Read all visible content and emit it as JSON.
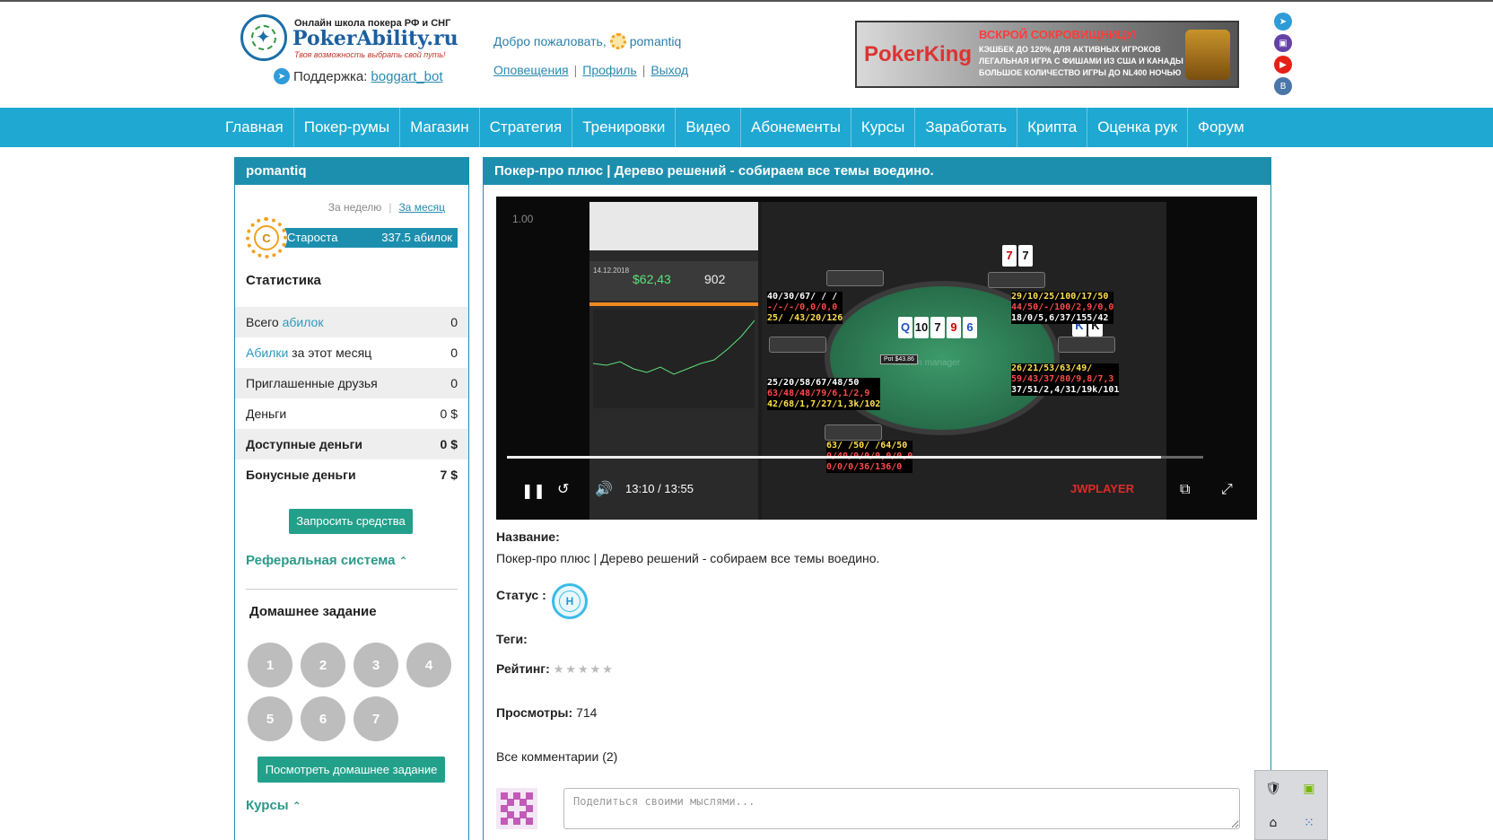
{
  "header": {
    "logo_tagline_top": "Онлайн школа покера РФ и СНГ",
    "logo_name": "PokerAbility.ru",
    "logo_tagline_bottom": "Твоя возможность выбрать свой путь!",
    "support_label": "Поддержка:",
    "support_link": "boggart_bot",
    "welcome": "Добро пожаловать,",
    "username": "pomantiq",
    "links": [
      "Оповещения",
      "Профиль",
      "Выход"
    ],
    "banner": {
      "brand_a": "Poker",
      "brand_b": "King",
      "headline": "ВСКРОЙ СОКРОВИЩНИЦУ!",
      "lines": [
        "КЭШБЕК ДО 120% ДЛЯ АКТИВНЫХ ИГРОКОВ",
        "ЛЕГАЛЬНАЯ ИГРА С ФИШАМИ ИЗ США И КАНАДЫ",
        "БОЛЬШОЕ КОЛИЧЕСТВО ИГРЫ ДО NL400 НОЧЬЮ"
      ]
    },
    "social_icons": [
      "telegram-icon",
      "twitch-icon",
      "youtube-icon",
      "vk-icon"
    ]
  },
  "nav": [
    "Главная",
    "Покер-румы",
    "Магазин",
    "Стратегия",
    "Тренировки",
    "Видео",
    "Абонементы",
    "Курсы",
    "Заработать",
    "Крипта",
    "Оценка рук",
    "Форум"
  ],
  "sidebar": {
    "title": "pomantiq",
    "period_week": "За неделю",
    "period_month": "За месяц",
    "rank_letter": "С",
    "rank_title": "Староста",
    "rank_points": "337.5 абилок",
    "stats_heading": "Статистика",
    "stats": [
      {
        "label_a": "Всего ",
        "label_hl": "абилок",
        "label_b": "",
        "value": "0"
      },
      {
        "label_a": "",
        "label_hl": "Абилки",
        "label_b": " за этот месяц",
        "value": "0"
      },
      {
        "label_a": "Приглашенные друзья",
        "label_hl": "",
        "label_b": "",
        "value": "0"
      },
      {
        "label_a": "Деньги",
        "label_hl": "",
        "label_b": "",
        "value": "0 $"
      },
      {
        "label_a": "Доступные деньги",
        "label_hl": "",
        "label_b": "",
        "value": "0 $"
      },
      {
        "label_a": "Бонусные деньги",
        "label_hl": "",
        "label_b": "",
        "value": "7 $"
      }
    ],
    "request_funds": "Запросить средства",
    "referral": "Реферальная система",
    "homework_heading": "Домашнее задание",
    "homework": [
      "1",
      "2",
      "3",
      "4",
      "5",
      "6",
      "7"
    ],
    "view_homework": "Посмотреть домашнее задание",
    "courses": "Курсы"
  },
  "main": {
    "title": "Покер-про плюс | Дерево решений - собираем все темы воедино.",
    "video": {
      "rate": "1.00",
      "time_current": "13:10",
      "time_total": "13:55",
      "progress": 0.94,
      "player_brand": "JWPLAYER",
      "screen": {
        "profit": "$62,43",
        "hands": "902",
        "date": "14.12.2018",
        "board": [
          "Q",
          "10",
          "7",
          "9",
          "6"
        ],
        "hero_cards": [
          "7",
          "7"
        ],
        "villain_cards": [
          "K",
          "K"
        ],
        "pot": "Pot $43.86",
        "watermark": "holdem manager",
        "hud1": [
          "40/30/67/ / /",
          "-/-/-/0,0/0,0",
          "25/ /43/20/126"
        ],
        "hud2": [
          "29/10/25/100/17/50",
          "44/50/-/100/2,9/0,0",
          "18/0/5,6/37/155/42"
        ],
        "hud3": [
          "26/21/53/63/49/",
          "59/43/37/80/9,8/7,3",
          "37/51/2,4/31/19k/101"
        ],
        "hud4": [
          "25/20/58/67/48/50",
          "63/48/48/79/6,1/2,9",
          "42/68/1,7/27/1,3k/102"
        ],
        "hud5": [
          "63/ /50/ /64/50",
          "0/40/0/0/0,0/0,0",
          "0/0/0/36/136/0"
        ]
      }
    },
    "name_label": "Название:",
    "name_value": "Покер-про плюс | Дерево решений - собираем все темы воедино.",
    "status_label": "Статус :",
    "status_letter": "Н",
    "tags_label": "Теги:",
    "rating_label": "Рейтинг:",
    "rating_stars": "★★★★★",
    "views_label": "Просмотры:",
    "views_value": "714",
    "comments_heading": "Все комментарии (2)",
    "comment_placeholder": "Поделиться своими мыслями..."
  },
  "colors": {
    "nav": "#1fa8d2",
    "panel_header": "#1d8fae",
    "button": "#23a08a",
    "link": "#2a8ab0"
  }
}
